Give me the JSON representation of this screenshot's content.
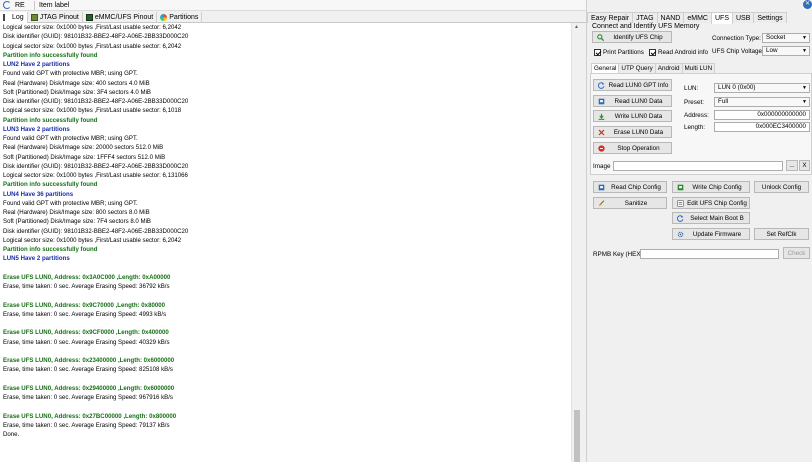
{
  "topbar": {
    "re_label": "RE",
    "item_label": "Item label"
  },
  "tabs": [
    {
      "label": "Log",
      "icon": "log-icon"
    },
    {
      "label": "JTAG Pinout",
      "icon": "jtag-pinout-icon"
    },
    {
      "label": "eMMC/UFS Pinout",
      "icon": "pinout-icon"
    },
    {
      "label": "Partitions",
      "icon": "partitions-icon"
    }
  ],
  "log_lines": [
    {
      "text": "Logical sector size: 0x1000  bytes ,First/Last usable sector: 6,2042",
      "style": "b-partial"
    },
    {
      "text": "Disk identifier (GUID): 98101B32-BBE2-48F2-A06E-2BB33D000C20",
      "style": ""
    },
    {
      "text": "Logical sector size: 0x1000  bytes ,First/Last usable sector: 6,2042",
      "style": ""
    },
    {
      "text": "Partition info successfully found",
      "style": "green"
    },
    {
      "text": "LUN2 Have 2 partitions",
      "style": "blue"
    },
    {
      "text": "Found valid GPT with protective MBR; using GPT.",
      "style": ""
    },
    {
      "text": "Real (Hardware) Disk/Image size: 400 sectors 4.0 MiB",
      "style": ""
    },
    {
      "text": "Soft (Partitioned) Disk/Image size: 3F4 sectors 4.0 MiB",
      "style": ""
    },
    {
      "text": "Disk identifier (GUID): 98101B32-BBE2-48F2-A06E-2BB33D000C20",
      "style": ""
    },
    {
      "text": "Logical sector size: 0x1000  bytes ,First/Last usable sector: 6,1018",
      "style": ""
    },
    {
      "text": "Partition info successfully found",
      "style": "green"
    },
    {
      "text": "LUN3 Have 2 partitions",
      "style": "blue"
    },
    {
      "text": "Found valid GPT with protective MBR; using GPT.",
      "style": ""
    },
    {
      "text": "Real (Hardware) Disk/Image size: 20000 sectors 512.0 MiB",
      "style": ""
    },
    {
      "text": "Soft (Partitioned) Disk/Image size: 1FFF4 sectors 512.0 MiB",
      "style": ""
    },
    {
      "text": "Disk identifier (GUID): 98101B32-BBE2-48F2-A06E-2BB33D000C20",
      "style": ""
    },
    {
      "text": "Logical sector size: 0x1000  bytes ,First/Last usable sector: 6,131066",
      "style": ""
    },
    {
      "text": "Partition info successfully found",
      "style": "green"
    },
    {
      "text": "LUN4 Have 36 partitions",
      "style": "blue"
    },
    {
      "text": "Found valid GPT with protective MBR; using GPT.",
      "style": ""
    },
    {
      "text": "Real (Hardware) Disk/Image size: 800 sectors 8.0 MiB",
      "style": ""
    },
    {
      "text": "Soft (Partitioned) Disk/Image size: 7F4 sectors 8.0 MiB",
      "style": ""
    },
    {
      "text": "Disk identifier (GUID): 98101B32-BBE2-48F2-A06E-2BB33D000C20",
      "style": ""
    },
    {
      "text": "Logical sector size: 0x1000  bytes ,First/Last usable sector: 6,2042",
      "style": ""
    },
    {
      "text": "Partition info successfully found",
      "style": "green"
    },
    {
      "text": "LUN5 Have 2 partitions",
      "style": "blue"
    },
    {
      "text": "",
      "style": "gap"
    },
    {
      "text": "Erase UFS LUN0, Address: 0x3A0C000 ,Length: 0xA00000",
      "style": "green"
    },
    {
      "text": "Erase, time taken: 0 sec. Average Erasing Speed: 36792 kB/s",
      "style": ""
    },
    {
      "text": "",
      "style": "gap"
    },
    {
      "text": "Erase UFS LUN0, Address: 0x9C70000 ,Length: 0x80000",
      "style": "green"
    },
    {
      "text": "Erase, time taken: 0 sec. Average Erasing Speed: 4993 kB/s",
      "style": ""
    },
    {
      "text": "",
      "style": "gap"
    },
    {
      "text": "Erase UFS LUN0, Address: 0x9CF0000 ,Length: 0x400000",
      "style": "green"
    },
    {
      "text": "Erase, time taken: 0 sec. Average Erasing Speed: 40329 kB/s",
      "style": ""
    },
    {
      "text": "",
      "style": "gap"
    },
    {
      "text": "Erase UFS LUN0, Address: 0x23400000 ,Length: 0x6000000",
      "style": "green"
    },
    {
      "text": "Erase, time taken: 0 sec. Average Erasing Speed: 825108 kB/s",
      "style": ""
    },
    {
      "text": "",
      "style": "gap"
    },
    {
      "text": "Erase UFS LUN0, Address: 0x29400000 ,Length: 0x6000000",
      "style": "green"
    },
    {
      "text": "Erase, time taken: 0 sec. Average Erasing Speed: 967916 kB/s",
      "style": ""
    },
    {
      "text": "",
      "style": "gap"
    },
    {
      "text": "Erase UFS LUN0, Address: 0x27BC00000 ,Length: 0x800000",
      "style": "green"
    },
    {
      "text": "Erase, time taken: 0 sec. Average Erasing Speed: 79137 kB/s",
      "style": ""
    },
    {
      "text": "Done.",
      "style": ""
    }
  ],
  "right_tabs": [
    "Easy Repair",
    "JTAG",
    "NAND",
    "eMMC",
    "UFS",
    "USB",
    "Settings"
  ],
  "right_active_tab": "UFS",
  "connect": {
    "title": "Connect and Identify UFS Memory",
    "identify_button": "Identify UFS Chip",
    "print_partitions": "Print Partitions",
    "read_android_info": "Read Android info",
    "connection_type_label": "Connection Type:",
    "connection_type_value": "Socket",
    "chip_voltage_label": "UFS Chip Voltage :",
    "chip_voltage_value": "Low"
  },
  "subtabs": [
    "General",
    "UTP Query",
    "Android",
    "Multi LUN"
  ],
  "subtab_active": "General",
  "ops": {
    "read_gpt": "Read LUN0 GPT Info",
    "read_data": "Read LUN0 Data",
    "write_data": "Write LUN0 Data",
    "erase_data": "Erase LUN0 Data",
    "stop": "Stop Operation"
  },
  "lun_form": {
    "lun_label": "LUN:",
    "lun_value": "LUN 0 (0x00)",
    "preset_label": "Preset:",
    "preset_value": "Full",
    "address_label": "Address:",
    "address_value": "0x000000000000",
    "length_label": "Length:",
    "length_value": "0x000EC3400000"
  },
  "image": {
    "label": "Image",
    "browse": "...",
    "clear": "X"
  },
  "chip_config": {
    "read": "Read Chip Config",
    "write": "Write Chip Config",
    "unlock": "Unlock Config",
    "sanitize": "Sanitize",
    "edit": "Edit UFS Chip Config",
    "select_boot": "Select Main Boot B",
    "update_firmware": "Update Firmware",
    "set_refclk": "Set RefClk"
  },
  "rpmb": {
    "label": "RPMB Key (HEX):",
    "check": "Check"
  }
}
